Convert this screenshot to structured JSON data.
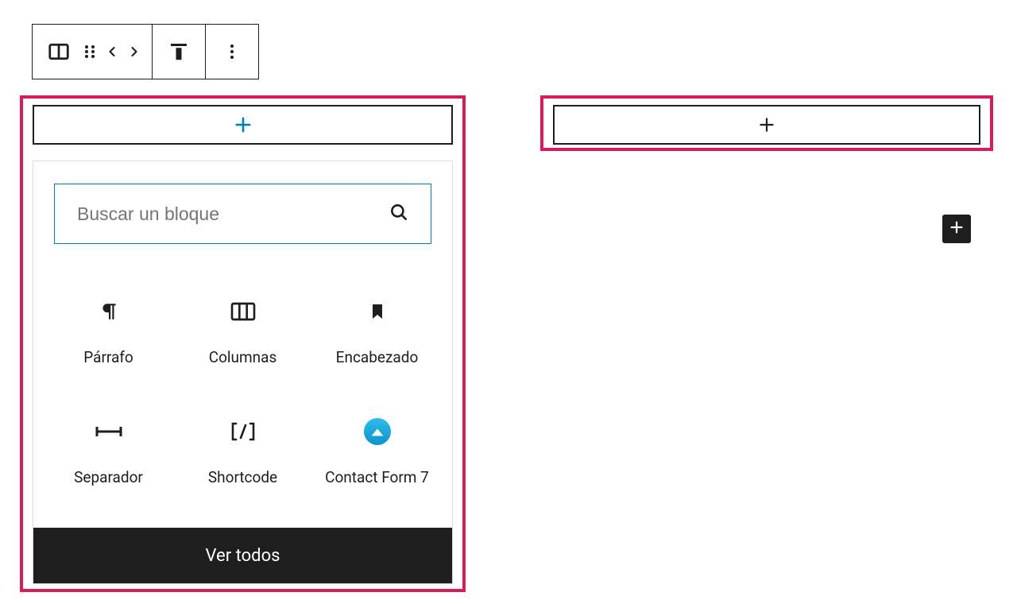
{
  "toolbar": {
    "columns_tool": "columns-icon",
    "drag_tool": "drag-handle-icon",
    "move_prev": "chevron-left-icon",
    "move_next": "chevron-right-icon",
    "align_tool": "vertical-align-top-icon",
    "more_tool": "more-vertical-icon"
  },
  "left_column": {
    "appender_icon": "plus-icon",
    "inserter": {
      "search_placeholder": "Buscar un bloque",
      "search_button": "search-icon",
      "blocks": [
        {
          "name": "paragraph",
          "label": "Párrafo",
          "icon": "pilcrow-icon"
        },
        {
          "name": "columns",
          "label": "Columnas",
          "icon": "columns3-icon"
        },
        {
          "name": "heading",
          "label": "Encabezado",
          "icon": "bookmark-icon"
        },
        {
          "name": "separator",
          "label": "Separador",
          "icon": "separator-icon"
        },
        {
          "name": "shortcode",
          "label": "Shortcode",
          "icon": "shortcode-icon"
        },
        {
          "name": "cf7",
          "label": "Contact Form 7",
          "icon": "cf7-icon"
        }
      ],
      "browse_all": "Ver todos"
    }
  },
  "right_column": {
    "appender_icon": "plus-icon"
  },
  "floating_add": {
    "icon": "plus-icon"
  },
  "colors": {
    "selection": "#d81b60",
    "accent": "#007cba",
    "ink": "#1e1e1e"
  }
}
